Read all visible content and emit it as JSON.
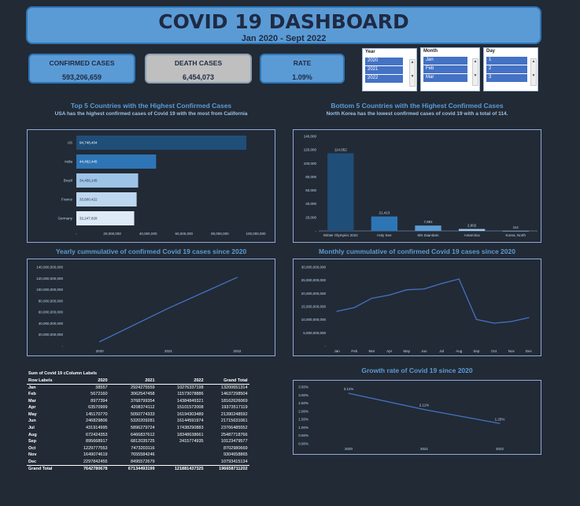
{
  "header": {
    "title": "COVID 19 DASHBOARD",
    "subtitle": "Jan 2020 - Sept 2022"
  },
  "kpis": {
    "confirmed": {
      "label": "CONFIRMED CASES",
      "value": "593,206,659"
    },
    "deaths": {
      "label": "DEATH CASES",
      "value": "6,454,073"
    },
    "rate": {
      "label": "RATE",
      "value": "1.09%"
    }
  },
  "slicers": {
    "year": {
      "label": "Year",
      "items": [
        "2020",
        "2021",
        "2022"
      ]
    },
    "month": {
      "label": "Month",
      "items": [
        "Jan",
        "Feb",
        "Mar"
      ]
    },
    "day": {
      "label": "Day",
      "items": [
        "1",
        "2",
        "3"
      ]
    }
  },
  "sections": {
    "top5": {
      "title": "Top 5 Countries with the Highest Confirmed Cases",
      "subtitle": "USA has the highest confirmed cases of Covid 19 with the most from California"
    },
    "bottom5": {
      "title": "Bottom 5 Countries with the Highest Confirmed Cases",
      "subtitle": "North Korea has the lowest confirmed cases of covid 19 with a total of 114."
    },
    "yearly": {
      "title": "Yearly cummulative of confirmed Covid 19 cases since 2020"
    },
    "monthly": {
      "title": "Monthly cummulative of confirmed Covid 19 cases since 2020"
    },
    "growth": {
      "title": "Growth rate of Covid 19 since 2020"
    }
  },
  "pivot": {
    "title": "Sum of Covid 19 cColumn Labels",
    "headers": [
      "Row Labels",
      "2020",
      "2021",
      "2022",
      "Grand Total"
    ],
    "rows": [
      [
        "Jan",
        "38557",
        "2924275559",
        "10276337198",
        "13200651314"
      ],
      [
        "Feb",
        "5672160",
        "3062547458",
        "11573078886",
        "14637298504"
      ],
      [
        "Mar",
        "8977394",
        "3768799354",
        "14384849321",
        "18162626069"
      ],
      [
        "Apr",
        "63570999",
        "4208374112",
        "15101572008",
        "19373517119"
      ],
      [
        "May",
        "145170770",
        "5050774333",
        "16194303489",
        "21390248592"
      ],
      [
        "Jun",
        "246829806",
        "5320209281",
        "16144591974",
        "21715631061"
      ],
      [
        "Jul",
        "431914995",
        "5896279724",
        "17438290883",
        "23766485552"
      ],
      [
        "Aug",
        "672424353",
        "6466837612",
        "18348638661",
        "25487718766"
      ],
      [
        "Sep",
        "895668917",
        "6812035725",
        "2415774935",
        "10123479577"
      ],
      [
        "Oct",
        "1229777553",
        "7473203116",
        "",
        "8702980669"
      ],
      [
        "Nov",
        "1649074619",
        "7655584246",
        "",
        "9304658865"
      ],
      [
        "Dec",
        "2297842455",
        "8495572679",
        "",
        "10793415134"
      ]
    ],
    "total": [
      "Grand Total",
      "7642780678",
      "67134493199",
      "121881437325",
      "196658711202"
    ]
  },
  "chart_data": [
    {
      "type": "bar",
      "orientation": "horizontal",
      "categories": [
        "US",
        "India",
        "Brazil",
        "France",
        "Germany"
      ],
      "values": [
        94748404,
        44462445,
        34456145,
        33600422,
        32247828
      ],
      "value_labels": [
        "94,748,404",
        "44,462,445",
        "34,456,145",
        "33,600,422",
        "32,247,828"
      ],
      "ticks": [
        "-",
        "20,000,000",
        "40,000,000",
        "60,000,000",
        "80,000,000",
        "100,000,000"
      ],
      "xlim": [
        0,
        100000000
      ],
      "colors": [
        "#1f4e79",
        "#2e75b6",
        "#9dc3e6",
        "#bdd7ee",
        "#deebf7"
      ]
    },
    {
      "type": "bar",
      "categories": [
        "Winter Olympics 2022",
        "Holy See",
        "MS Zaandam",
        "Antarctica",
        "Korea, North"
      ],
      "values": [
        114952,
        21413,
        7981,
        2902,
        114
      ],
      "value_labels": [
        "114,952",
        "21,413",
        "7,981",
        "2,902",
        "114"
      ],
      "ticks": [
        "-",
        "20,000",
        "40,000",
        "60,000",
        "80,000",
        "100,000",
        "120,000",
        "140,000"
      ],
      "ylim": [
        0,
        140000
      ],
      "colors": [
        "#1f4e79",
        "#2e75b6",
        "#5b9bd5",
        "#9dc3e6",
        "#bdd7ee"
      ]
    },
    {
      "type": "line",
      "x": [
        "2020",
        "2021",
        "2022"
      ],
      "values": [
        7642780678,
        67134493199,
        121881437325
      ],
      "ticks": [
        "-",
        "20,000,000,000",
        "40,000,000,000",
        "60,000,000,000",
        "80,000,000,000",
        "100,000,000,000",
        "120,000,000,000",
        "140,000,000,000"
      ],
      "ylim": [
        0,
        140000000000
      ],
      "color": "#4472c4"
    },
    {
      "type": "line",
      "x": [
        "Jan",
        "Feb",
        "Mar",
        "Apr",
        "May",
        "Jun",
        "Jul",
        "Aug",
        "Sep",
        "Oct",
        "Nov",
        "Dec"
      ],
      "values": [
        13200651314,
        14637298504,
        18162626069,
        19373517119,
        21390248592,
        21715631061,
        23766485552,
        25487718766,
        10123479577,
        8702980669,
        9304658865,
        10793415134
      ],
      "ticks": [
        "-",
        "5,000,000,000",
        "10,000,000,000",
        "15,000,000,000",
        "20,000,000,000",
        "25,000,000,000",
        "30,000,000,000"
      ],
      "ylim": [
        0,
        30000000000
      ],
      "color": "#4472c4"
    },
    {
      "type": "line",
      "x": [
        "2020",
        "2021",
        "2022"
      ],
      "values": [
        3.11,
        2.11,
        1.25
      ],
      "value_labels": [
        "3.11%",
        "2.11%",
        "1.25%"
      ],
      "ticks": [
        "0.00%",
        "0.50%",
        "1.00%",
        "1.50%",
        "2.00%",
        "2.50%",
        "3.00%",
        "3.50%"
      ],
      "ylim": [
        0,
        3.5
      ],
      "color": "#4472c4"
    }
  ]
}
